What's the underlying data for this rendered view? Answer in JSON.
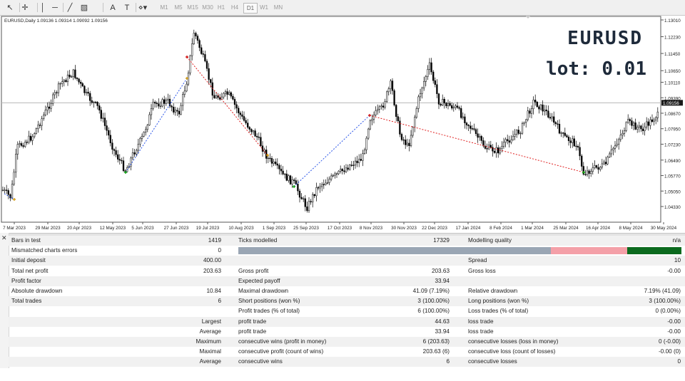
{
  "toolbar": {
    "tools": [
      {
        "name": "cursor-icon",
        "glyph": "↖"
      },
      {
        "name": "crosshair-icon",
        "glyph": "✛"
      },
      {
        "name": "vertical-line-icon",
        "glyph": "│"
      },
      {
        "name": "horizontal-line-icon",
        "glyph": "─"
      },
      {
        "name": "trendline-icon",
        "glyph": "╱"
      },
      {
        "name": "channel-icon",
        "glyph": "▨"
      },
      {
        "name": "text-tool-icon",
        "glyph": "A"
      },
      {
        "name": "label-tool-icon",
        "glyph": "T"
      },
      {
        "name": "shapes-menu-icon",
        "glyph": "⋄▾"
      }
    ],
    "timeframes": [
      "M1",
      "M5",
      "M15",
      "M30",
      "H1",
      "H4",
      "D1",
      "W1",
      "MN"
    ],
    "active_timeframe": "D1"
  },
  "chart": {
    "header": "EURUSD,Daily  1.09136 1.09314 1.09092 1.09156",
    "watermark_symbol": "EURUSD",
    "watermark_lot": "lot: 0.01",
    "price_labels": [
      "1.13010",
      "1.12230",
      "1.11450",
      "1.10650",
      "1.10110",
      "1.09390",
      "1.08670",
      "1.07950",
      "1.07230",
      "1.06490",
      "1.05770",
      "1.05050",
      "1.04330"
    ],
    "current_price_label": "1.09156",
    "current_price": 1.09156,
    "date_labels": [
      "7 Mar 2023",
      "29 Mar 2023",
      "20 Apr 2023",
      "12 May 2023",
      "5 Jun 2023",
      "27 Jun 2023",
      "19 Jul 2023",
      "10 Aug 2023",
      "1 Sep 2023",
      "25 Sep 2023",
      "17 Oct 2023",
      "8 Nov 2023",
      "30 Nov 2023",
      "22 Dec 2023",
      "17 Jan 2024",
      "8 Feb 2024",
      "1 Mar 2024",
      "25 Mar 2024",
      "16 Apr 2024",
      "8 May 2024",
      "30 May 2024"
    ],
    "colors": {
      "buy_line": "#2a55e8",
      "sell_line": "#e02020",
      "buy_marker": "#17a317",
      "sell_marker": "#d42020",
      "close_marker": "#d4a020",
      "candle": "#000000",
      "price_line": "#b8b8b8"
    }
  },
  "report": {
    "rows": [
      {
        "cells": [
          "Bars in test",
          "1419",
          "Ticks modelled",
          "17329",
          "Modelling quality",
          "n/a"
        ]
      },
      {
        "cells": [
          "Mismatched charts errors",
          "0",
          "",
          "",
          "",
          ""
        ],
        "quality_bar": true
      },
      {
        "cells": [
          "Initial deposit",
          "400.00",
          "",
          "",
          "Spread",
          "10"
        ]
      },
      {
        "cells": [
          "Total net profit",
          "203.63",
          "Gross profit",
          "203.63",
          "Gross loss",
          "-0.00"
        ]
      },
      {
        "cells": [
          "Profit factor",
          "",
          "Expected payoff",
          "33.94",
          "",
          ""
        ]
      },
      {
        "cells": [
          "Absolute drawdown",
          "10.84",
          "Maximal drawdown",
          "41.09 (7.19%)",
          "Relative drawdown",
          "7.19% (41.09)"
        ]
      },
      {
        "cells": [
          "Total trades",
          "6",
          "Short positions (won %)",
          "3 (100.00%)",
          "Long positions (won %)",
          "3 (100.00%)"
        ]
      },
      {
        "cells": [
          "",
          "",
          "Profit trades (% of total)",
          "6 (100.00%)",
          "Loss trades (% of total)",
          "0 (0.00%)"
        ]
      },
      {
        "cells": [
          "",
          "Largest",
          "profit trade",
          "44.63",
          "loss trade",
          "-0.00"
        ]
      },
      {
        "cells": [
          "",
          "Average",
          "profit trade",
          "33.94",
          "loss trade",
          "-0.00"
        ]
      },
      {
        "cells": [
          "",
          "Maximum",
          "consecutive wins (profit in money)",
          "6 (203.63)",
          "consecutive losses (loss in money)",
          "0 (-0.00)"
        ]
      },
      {
        "cells": [
          "",
          "Maximal",
          "consecutive profit (count of wins)",
          "203.63 (6)",
          "consecutive loss (count of losses)",
          "-0.00 (0)"
        ]
      },
      {
        "cells": [
          "",
          "Average",
          "consecutive wins",
          "6",
          "consecutive losses",
          "0"
        ]
      }
    ],
    "quality_colors": [
      "#9aa6b4",
      "#f4a0a8",
      "#0b6a1e"
    ]
  }
}
